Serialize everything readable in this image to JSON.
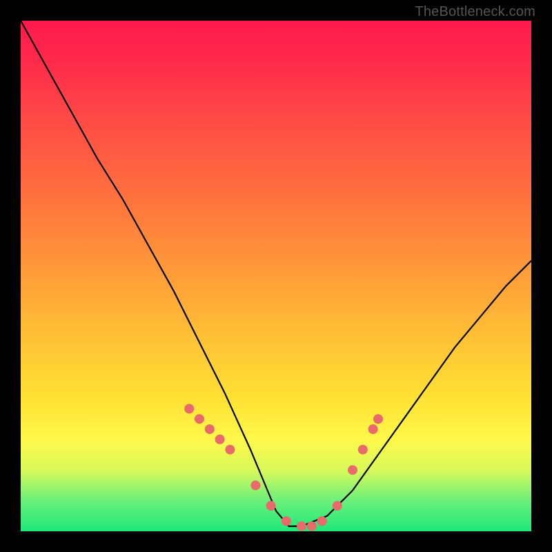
{
  "watermark": {
    "text": "TheBottleneck.com"
  },
  "chart_data": {
    "type": "line",
    "title": "",
    "xlabel": "",
    "ylabel": "",
    "x_range": [
      0,
      1
    ],
    "y_range": [
      0,
      1
    ],
    "series": [
      {
        "name": "curve",
        "color": "#000000",
        "x": [
          0.0,
          0.05,
          0.1,
          0.15,
          0.2,
          0.25,
          0.3,
          0.35,
          0.4,
          0.45,
          0.5,
          0.525,
          0.55,
          0.6,
          0.65,
          0.7,
          0.75,
          0.8,
          0.85,
          0.9,
          0.95,
          1.0
        ],
        "y": [
          1.0,
          0.91,
          0.82,
          0.73,
          0.65,
          0.56,
          0.47,
          0.37,
          0.27,
          0.16,
          0.04,
          0.01,
          0.01,
          0.03,
          0.08,
          0.15,
          0.22,
          0.29,
          0.36,
          0.42,
          0.48,
          0.53
        ]
      },
      {
        "name": "dots",
        "color": "#e86a6a",
        "type": "scatter",
        "x": [
          0.33,
          0.35,
          0.37,
          0.39,
          0.41,
          0.46,
          0.49,
          0.52,
          0.55,
          0.57,
          0.59,
          0.62,
          0.65,
          0.67,
          0.69,
          0.7
        ],
        "y": [
          0.24,
          0.22,
          0.2,
          0.18,
          0.16,
          0.09,
          0.05,
          0.02,
          0.01,
          0.01,
          0.02,
          0.05,
          0.12,
          0.16,
          0.2,
          0.22
        ]
      }
    ],
    "notes": "Values are normalized 0..1 fractions of the plot area; y=0 is the bottom (green), y=1 is the top (red). Curve is a steep descending line from top-left reaching a flat minimum near x≈0.53 then rising more gently to mid-right. Salmon dots cluster along the curve near the minimum."
  }
}
